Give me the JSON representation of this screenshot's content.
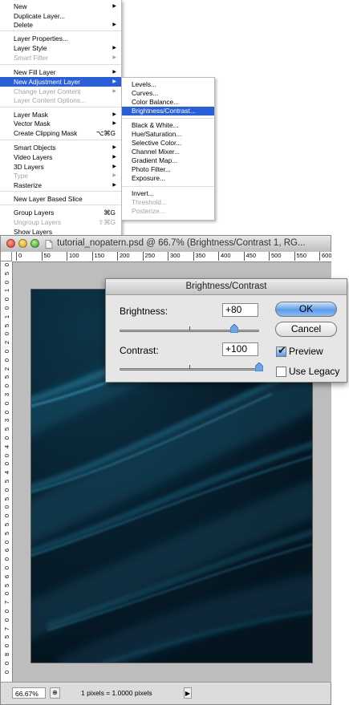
{
  "layer_menu": {
    "items": [
      {
        "label": "New",
        "arrow": true
      },
      {
        "label": "Duplicate Layer..."
      },
      {
        "label": "Delete",
        "arrow": true
      },
      {
        "label": "Layer Properties..."
      },
      {
        "label": "Layer Style",
        "arrow": true
      },
      {
        "label": "Smart Filter",
        "arrow": true,
        "disabled": true
      },
      {
        "label": "New Fill Layer",
        "arrow": true
      },
      {
        "label": "New Adjustment Layer",
        "arrow": true,
        "highlighted": true
      },
      {
        "label": "Change Layer Content",
        "arrow": true,
        "disabled": true
      },
      {
        "label": "Layer Content Options...",
        "disabled": true
      },
      {
        "label": "Layer Mask",
        "arrow": true
      },
      {
        "label": "Vector Mask",
        "arrow": true
      },
      {
        "label": "Create Clipping Mask",
        "shortcut": "⌥⌘G"
      },
      {
        "label": "Smart Objects",
        "arrow": true
      },
      {
        "label": "Video Layers",
        "arrow": true
      },
      {
        "label": "3D Layers",
        "arrow": true
      },
      {
        "label": "Type",
        "arrow": true,
        "disabled": true
      },
      {
        "label": "Rasterize",
        "arrow": true
      },
      {
        "label": "New Layer Based Slice"
      },
      {
        "label": "Group Layers",
        "shortcut": "⌘G"
      },
      {
        "label": "Ungroup Layers",
        "shortcut": "⇧⌘G",
        "disabled": true
      },
      {
        "label": "Show Layers"
      }
    ]
  },
  "adjustment_submenu": {
    "items": [
      {
        "label": "Levels..."
      },
      {
        "label": "Curves..."
      },
      {
        "label": "Color Balance..."
      },
      {
        "label": "Brightness/Contrast...",
        "highlighted": true
      },
      {
        "label": "Black & White..."
      },
      {
        "label": "Hue/Saturation..."
      },
      {
        "label": "Selective Color..."
      },
      {
        "label": "Channel Mixer..."
      },
      {
        "label": "Gradient Map..."
      },
      {
        "label": "Photo Filter..."
      },
      {
        "label": "Exposure..."
      },
      {
        "label": "Invert..."
      },
      {
        "label": "Threshold...",
        "disabled": true
      },
      {
        "label": "Posterize...",
        "disabled": true
      }
    ]
  },
  "document": {
    "title": "tutorial_nopatern.psd @ 66.7% (Brightness/Contrast 1, RG...",
    "ruler_h": [
      "0",
      "50",
      "100",
      "150",
      "200",
      "250",
      "300",
      "350",
      "400",
      "450",
      "500",
      "550",
      "600"
    ],
    "ruler_v": [
      "0",
      "5",
      "0",
      "1",
      "0",
      "0",
      "1",
      "5",
      "0",
      "2",
      "0",
      "0",
      "2",
      "5",
      "0",
      "3",
      "0",
      "0",
      "3",
      "5",
      "0",
      "4",
      "0",
      "0",
      "4",
      "5",
      "0",
      "5",
      "0",
      "0",
      "5",
      "5",
      "0",
      "6",
      "0",
      "0",
      "6",
      "5",
      "0",
      "7",
      "0",
      "0",
      "7",
      "5",
      "0",
      "8",
      "0",
      "0"
    ],
    "zoom": "66.67%",
    "status": "1 pixels = 1.0000 pixels"
  },
  "dialog": {
    "title": "Brightness/Contrast",
    "brightness_label": "Brightness:",
    "brightness_value": "+80",
    "contrast_label": "Contrast:",
    "contrast_value": "+100",
    "ok_label": "OK",
    "cancel_label": "Cancel",
    "preview_label": "Preview",
    "preview_checked": true,
    "legacy_label": "Use Legacy",
    "legacy_checked": false,
    "brightness_level": 0.8,
    "contrast_level": 1.0
  },
  "colors": {
    "highlight": "#2a5fd8",
    "canvas_dark": "#071c29",
    "streak": "#1d6f8f"
  }
}
